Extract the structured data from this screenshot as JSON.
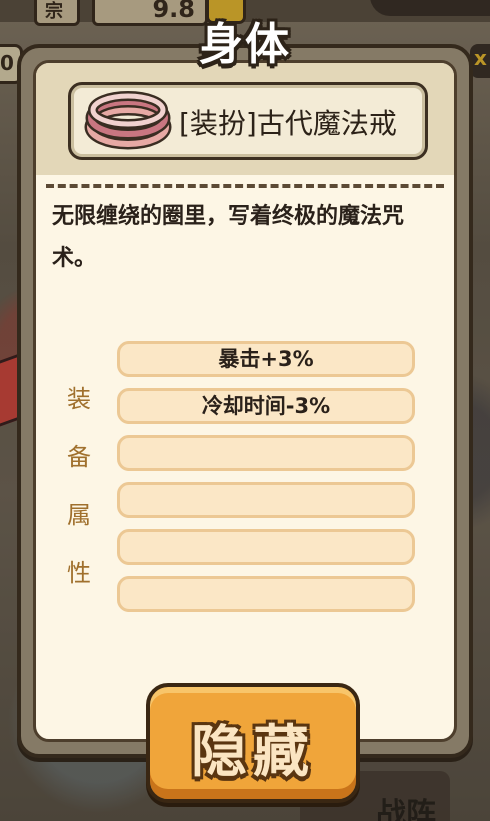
{
  "background": {
    "top_value": "9.8",
    "top_left_glyph": "宗",
    "side_left_glyph": "0",
    "side_right_glyph": "x",
    "bottom_right_text": "战阵"
  },
  "panel": {
    "title": "身体",
    "item": {
      "name": "[装扮]古代魔法戒",
      "icon": "ring-icon"
    },
    "description": "无限缠绕的圈里，写着终极的魔法咒术。",
    "attributes": {
      "label_chars": [
        "装",
        "备",
        "属",
        "性"
      ],
      "slots": [
        "暴击+3%",
        "冷却时间-3%",
        "",
        "",
        "",
        ""
      ]
    },
    "hide_button_label": "隐藏"
  },
  "colors": {
    "panel_border": "#34291c",
    "panel_paper": "#fdf6e5",
    "header_paper": "#e3d7b8",
    "attr_label": "#a0702d",
    "slot_fill": "#fbe7c6",
    "slot_border": "#ecc894",
    "button_orange": "#f0a53a"
  }
}
